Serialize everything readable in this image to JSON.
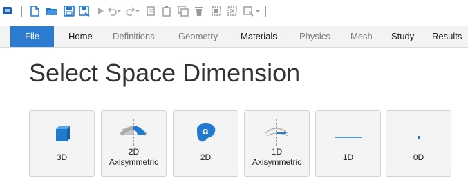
{
  "ribbon": {
    "tabs": [
      {
        "label": "File"
      },
      {
        "label": "Home"
      },
      {
        "label": "Definitions"
      },
      {
        "label": "Geometry"
      },
      {
        "label": "Materials"
      },
      {
        "label": "Physics"
      },
      {
        "label": "Mesh"
      },
      {
        "label": "Study"
      },
      {
        "label": "Results"
      }
    ]
  },
  "main": {
    "title": "Select Space Dimension",
    "buttons": [
      {
        "label": "3D",
        "icon": "cube-icon"
      },
      {
        "label": "2D\nAxisymmetric",
        "icon": "axisymmetric-2d-icon"
      },
      {
        "label": "2D",
        "icon": "domain-2d-icon"
      },
      {
        "label": "1D\nAxisymmetric",
        "icon": "axisymmetric-1d-icon"
      },
      {
        "label": "1D",
        "icon": "line-1d-icon"
      },
      {
        "label": "0D",
        "icon": "point-0d-icon"
      }
    ]
  },
  "colors": {
    "file_tab": "#2b7bd1",
    "icon_blue": "#1f7ad0",
    "icon_grey": "#9aa0a6"
  }
}
